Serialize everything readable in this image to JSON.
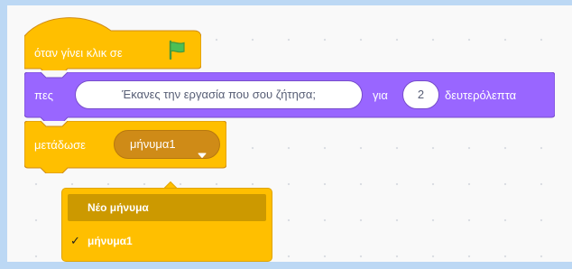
{
  "blocks": {
    "hat": {
      "label": "όταν γίνει κλικ σε",
      "flag_icon": "green-flag-icon",
      "color": "#ffbf00"
    },
    "say": {
      "label": "πες",
      "message_value": "Έκανες την εργασία που σου ζήτησα;",
      "for_label": "για",
      "seconds_value": "2",
      "seconds_label": "δευτερόλεπτα",
      "color": "#9966ff"
    },
    "broadcast": {
      "label": "μετάδωσε",
      "selected_message": "μήνυμα1",
      "caret_icon": "caret-down-icon",
      "color": "#ffbf00"
    }
  },
  "dropdown": {
    "items": [
      {
        "label": "Νέο μήνυμα",
        "highlighted": true,
        "checked": false
      },
      {
        "label": "μήνυμα1",
        "highlighted": false,
        "checked": true
      }
    ],
    "check_mark": "✓",
    "check_icon": "checkmark-icon",
    "highlight_color": "#cc9900"
  }
}
